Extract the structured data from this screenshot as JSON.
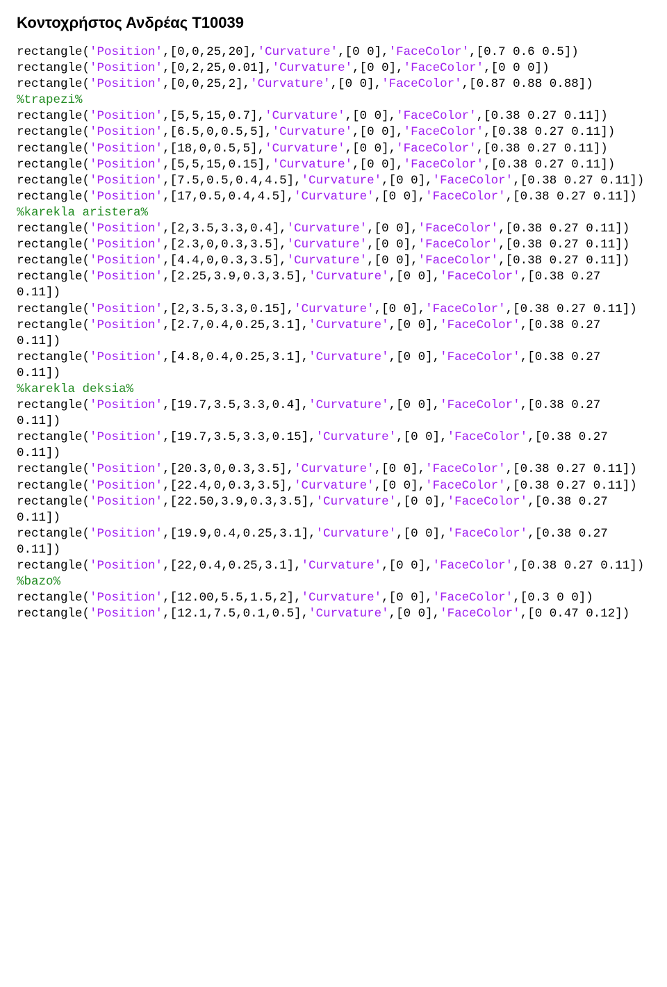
{
  "title": "Κοντοχρήστος Ανδρέας Τ10039",
  "lines": [
    [
      {
        "t": "rectangle("
      },
      {
        "t": "'Position'",
        "c": "str"
      },
      {
        "t": ",[0,0,25,20],"
      },
      {
        "t": "'Curvature'",
        "c": "str"
      },
      {
        "t": ",[0 0],"
      },
      {
        "t": "'FaceColor'",
        "c": "str"
      },
      {
        "t": ",[0.7 0.6 0.5])"
      }
    ],
    [
      {
        "t": "rectangle("
      },
      {
        "t": "'Position'",
        "c": "str"
      },
      {
        "t": ",[0,2,25,0.01],"
      },
      {
        "t": "'Curvature'",
        "c": "str"
      },
      {
        "t": ",[0 0],"
      },
      {
        "t": "'FaceColor'",
        "c": "str"
      },
      {
        "t": ",[0 0 0])"
      }
    ],
    [
      {
        "t": "rectangle("
      },
      {
        "t": "'Position'",
        "c": "str"
      },
      {
        "t": ",[0,0,25,2],"
      },
      {
        "t": "'Curvature'",
        "c": "str"
      },
      {
        "t": ",[0 0],"
      },
      {
        "t": "'FaceColor'",
        "c": "str"
      },
      {
        "t": ",[0.87 0.88 0.88])"
      }
    ],
    [
      {
        "t": "%trapezi%",
        "c": "com"
      }
    ],
    [
      {
        "t": "rectangle("
      },
      {
        "t": "'Position'",
        "c": "str"
      },
      {
        "t": ",[5,5,15,0.7],"
      },
      {
        "t": "'Curvature'",
        "c": "str"
      },
      {
        "t": ",[0 0],"
      },
      {
        "t": "'FaceColor'",
        "c": "str"
      },
      {
        "t": ",[0.38 0.27 0.11])"
      }
    ],
    [
      {
        "t": "rectangle("
      },
      {
        "t": "'Position'",
        "c": "str"
      },
      {
        "t": ",[6.5,0,0.5,5],"
      },
      {
        "t": "'Curvature'",
        "c": "str"
      },
      {
        "t": ",[0 0],"
      },
      {
        "t": "'FaceColor'",
        "c": "str"
      },
      {
        "t": ",[0.38 0.27 0.11])"
      }
    ],
    [
      {
        "t": "rectangle("
      },
      {
        "t": "'Position'",
        "c": "str"
      },
      {
        "t": ",[18,0,0.5,5],"
      },
      {
        "t": "'Curvature'",
        "c": "str"
      },
      {
        "t": ",[0 0],"
      },
      {
        "t": "'FaceColor'",
        "c": "str"
      },
      {
        "t": ",[0.38 0.27 0.11])"
      }
    ],
    [
      {
        "t": "rectangle("
      },
      {
        "t": "'Position'",
        "c": "str"
      },
      {
        "t": ",[5,5,15,0.15],"
      },
      {
        "t": "'Curvature'",
        "c": "str"
      },
      {
        "t": ",[0 0],"
      },
      {
        "t": "'FaceColor'",
        "c": "str"
      },
      {
        "t": ",[0.38 0.27 0.11])"
      }
    ],
    [
      {
        "t": "rectangle("
      },
      {
        "t": "'Position'",
        "c": "str"
      },
      {
        "t": ",[7.5,0.5,0.4,4.5],"
      },
      {
        "t": "'Curvature'",
        "c": "str"
      },
      {
        "t": ",[0 0],"
      },
      {
        "t": "'FaceColor'",
        "c": "str"
      },
      {
        "t": ",[0.38 0.27 0.11])"
      }
    ],
    [
      {
        "t": "rectangle("
      },
      {
        "t": "'Position'",
        "c": "str"
      },
      {
        "t": ",[17,0.5,0.4,4.5],"
      },
      {
        "t": "'Curvature'",
        "c": "str"
      },
      {
        "t": ",[0 0],"
      },
      {
        "t": "'FaceColor'",
        "c": "str"
      },
      {
        "t": ",[0.38 0.27 0.11])"
      }
    ],
    [
      {
        "t": "%karekla aristera%",
        "c": "com"
      }
    ],
    [
      {
        "t": "rectangle("
      },
      {
        "t": "'Position'",
        "c": "str"
      },
      {
        "t": ",[2,3.5,3.3,0.4],"
      },
      {
        "t": "'Curvature'",
        "c": "str"
      },
      {
        "t": ",[0 0],"
      },
      {
        "t": "'FaceColor'",
        "c": "str"
      },
      {
        "t": ",[0.38 0.27 0.11])"
      }
    ],
    [
      {
        "t": "rectangle("
      },
      {
        "t": "'Position'",
        "c": "str"
      },
      {
        "t": ",[2.3,0,0.3,3.5],"
      },
      {
        "t": "'Curvature'",
        "c": "str"
      },
      {
        "t": ",[0 0],"
      },
      {
        "t": "'FaceColor'",
        "c": "str"
      },
      {
        "t": ",[0.38 0.27 0.11])"
      }
    ],
    [
      {
        "t": "rectangle("
      },
      {
        "t": "'Position'",
        "c": "str"
      },
      {
        "t": ",[4.4,0,0.3,3.5],"
      },
      {
        "t": "'Curvature'",
        "c": "str"
      },
      {
        "t": ",[0 0],"
      },
      {
        "t": "'FaceColor'",
        "c": "str"
      },
      {
        "t": ",[0.38 0.27 0.11])"
      }
    ],
    [
      {
        "t": "rectangle("
      },
      {
        "t": "'Position'",
        "c": "str"
      },
      {
        "t": ",[2.25,3.9,0.3,3.5],"
      },
      {
        "t": "'Curvature'",
        "c": "str"
      },
      {
        "t": ",[0 0],"
      },
      {
        "t": "'FaceColor'",
        "c": "str"
      },
      {
        "t": ",[0.38 0.27 0.11])"
      }
    ],
    [
      {
        "t": "rectangle("
      },
      {
        "t": "'Position'",
        "c": "str"
      },
      {
        "t": ",[2,3.5,3.3,0.15],"
      },
      {
        "t": "'Curvature'",
        "c": "str"
      },
      {
        "t": ",[0 0],"
      },
      {
        "t": "'FaceColor'",
        "c": "str"
      },
      {
        "t": ",[0.38 0.27 0.11])"
      }
    ],
    [
      {
        "t": "rectangle("
      },
      {
        "t": "'Position'",
        "c": "str"
      },
      {
        "t": ",[2.7,0.4,0.25,3.1],"
      },
      {
        "t": "'Curvature'",
        "c": "str"
      },
      {
        "t": ",[0 0],"
      },
      {
        "t": "'FaceColor'",
        "c": "str"
      },
      {
        "t": ",[0.38 0.27 0.11])"
      }
    ],
    [
      {
        "t": "rectangle("
      },
      {
        "t": "'Position'",
        "c": "str"
      },
      {
        "t": ",[4.8,0.4,0.25,3.1],"
      },
      {
        "t": "'Curvature'",
        "c": "str"
      },
      {
        "t": ",[0 0],"
      },
      {
        "t": "'FaceColor'",
        "c": "str"
      },
      {
        "t": ",[0.38 0.27 0.11])"
      }
    ],
    [
      {
        "t": "%karekla deksia%",
        "c": "com"
      }
    ],
    [
      {
        "t": "rectangle("
      },
      {
        "t": "'Position'",
        "c": "str"
      },
      {
        "t": ",[19.7,3.5,3.3,0.4],"
      },
      {
        "t": "'Curvature'",
        "c": "str"
      },
      {
        "t": ",[0 0],"
      },
      {
        "t": "'FaceColor'",
        "c": "str"
      },
      {
        "t": ",[0.38 0.27 0.11])"
      }
    ],
    [
      {
        "t": "rectangle("
      },
      {
        "t": "'Position'",
        "c": "str"
      },
      {
        "t": ",[19.7,3.5,3.3,0.15],"
      },
      {
        "t": "'Curvature'",
        "c": "str"
      },
      {
        "t": ",[0 0],"
      },
      {
        "t": "'FaceColor'",
        "c": "str"
      },
      {
        "t": ",[0.38 0.27 0.11])"
      }
    ],
    [
      {
        "t": "rectangle("
      },
      {
        "t": "'Position'",
        "c": "str"
      },
      {
        "t": ",[20.3,0,0.3,3.5],"
      },
      {
        "t": "'Curvature'",
        "c": "str"
      },
      {
        "t": ",[0 0],"
      },
      {
        "t": "'FaceColor'",
        "c": "str"
      },
      {
        "t": ",[0.38 0.27 0.11])"
      }
    ],
    [
      {
        "t": "rectangle("
      },
      {
        "t": "'Position'",
        "c": "str"
      },
      {
        "t": ",[22.4,0,0.3,3.5],"
      },
      {
        "t": "'Curvature'",
        "c": "str"
      },
      {
        "t": ",[0 0],"
      },
      {
        "t": "'FaceColor'",
        "c": "str"
      },
      {
        "t": ",[0.38 0.27 0.11])"
      }
    ],
    [
      {
        "t": "rectangle("
      },
      {
        "t": "'Position'",
        "c": "str"
      },
      {
        "t": ",[22.50,3.9,0.3,3.5],"
      },
      {
        "t": "'Curvature'",
        "c": "str"
      },
      {
        "t": ",[0 0],"
      },
      {
        "t": "'FaceColor'",
        "c": "str"
      },
      {
        "t": ",[0.38 0.27 0.11])"
      }
    ],
    [
      {
        "t": "rectangle("
      },
      {
        "t": "'Position'",
        "c": "str"
      },
      {
        "t": ",[19.9,0.4,0.25,3.1],"
      },
      {
        "t": "'Curvature'",
        "c": "str"
      },
      {
        "t": ",[0 0],"
      },
      {
        "t": "'FaceColor'",
        "c": "str"
      },
      {
        "t": ",[0.38 0.27 0.11])"
      }
    ],
    [
      {
        "t": "rectangle("
      },
      {
        "t": "'Position'",
        "c": "str"
      },
      {
        "t": ",[22,0.4,0.25,3.1],"
      },
      {
        "t": "'Curvature'",
        "c": "str"
      },
      {
        "t": ",[0 0],"
      },
      {
        "t": "'FaceColor'",
        "c": "str"
      },
      {
        "t": ",[0.38 0.27 0.11])"
      }
    ],
    [
      {
        "t": "%bazo%",
        "c": "com"
      }
    ],
    [
      {
        "t": "rectangle("
      },
      {
        "t": "'Position'",
        "c": "str"
      },
      {
        "t": ",[12.00,5.5,1.5,2],"
      },
      {
        "t": "'Curvature'",
        "c": "str"
      },
      {
        "t": ",[0 0],"
      },
      {
        "t": "'FaceColor'",
        "c": "str"
      },
      {
        "t": ",[0.3 0 0])"
      }
    ],
    [
      {
        "t": "rectangle("
      },
      {
        "t": "'Position'",
        "c": "str"
      },
      {
        "t": ",[12.1,7.5,0.1,0.5],"
      },
      {
        "t": "'Curvature'",
        "c": "str"
      },
      {
        "t": ",[0 0],"
      },
      {
        "t": "'FaceColor'",
        "c": "str"
      },
      {
        "t": ",[0 0.47 0.12])"
      }
    ]
  ]
}
